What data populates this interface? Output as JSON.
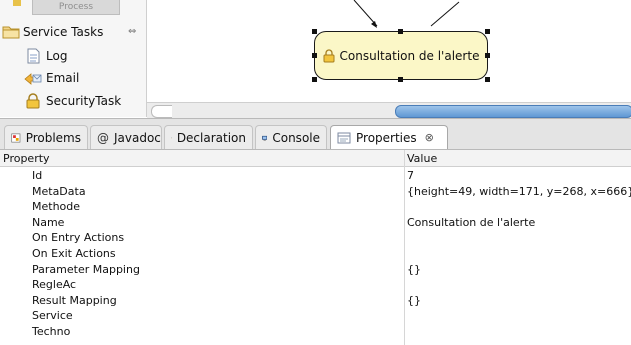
{
  "palette": {
    "process_label": "Process",
    "group": {
      "label": "Service Tasks",
      "icon": "folder-icon",
      "collapse_icon": "collapse-arrows-icon"
    },
    "items": [
      {
        "label": "Log",
        "icon": "document-icon"
      },
      {
        "label": "Email",
        "icon": "email-icon"
      },
      {
        "label": "SecurityTask",
        "icon": "lock-icon"
      }
    ]
  },
  "canvas": {
    "node": {
      "label": "Consultation de l'alerte",
      "icon": "lock-icon",
      "fill": "#fbf7c7"
    }
  },
  "tabs": [
    {
      "label": "Problems",
      "icon": "problems-icon"
    },
    {
      "label": "Javadoc",
      "icon": "at-sign-icon"
    },
    {
      "label": "Declaration",
      "icon": "declaration-icon"
    },
    {
      "label": "Console",
      "icon": "console-icon"
    },
    {
      "label": "Properties",
      "icon": "properties-icon",
      "active": true,
      "close": "⊗"
    }
  ],
  "properties": {
    "columns": {
      "property": "Property",
      "value": "Value"
    },
    "rows": [
      {
        "name": "Id",
        "value": "7"
      },
      {
        "name": "MetaData",
        "value": "{height=49, width=171, y=268, x=666}"
      },
      {
        "name": "Methode",
        "value": ""
      },
      {
        "name": "Name",
        "value": "Consultation de l'alerte"
      },
      {
        "name": "On Entry Actions",
        "value": ""
      },
      {
        "name": "On Exit Actions",
        "value": ""
      },
      {
        "name": "Parameter Mapping",
        "value": "{}"
      },
      {
        "name": "RegleAc",
        "value": ""
      },
      {
        "name": "Result Mapping",
        "value": "{}"
      },
      {
        "name": "Service",
        "value": ""
      },
      {
        "name": "Techno",
        "value": ""
      }
    ]
  }
}
